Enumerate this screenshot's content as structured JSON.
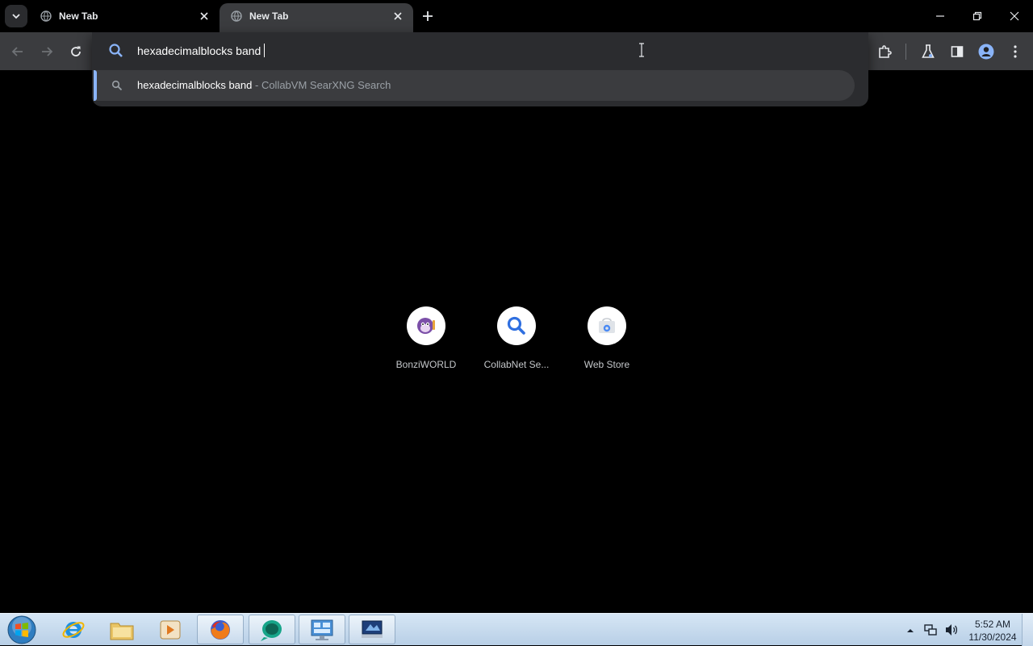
{
  "browser": {
    "tabs": [
      {
        "title": "New Tab",
        "active": false
      },
      {
        "title": "New Tab",
        "active": true
      }
    ],
    "omnibox": {
      "text": "hexadecimalblocks band",
      "suggestion": {
        "query": "hexadecimalblocks band",
        "separator": " - ",
        "engine": "CollabVM SearXNG Search"
      }
    },
    "shortcuts": [
      {
        "label": "BonziWORLD",
        "icon": "bonzi-icon"
      },
      {
        "label": "CollabNet Se...",
        "icon": "magnifier-icon"
      },
      {
        "label": "Web Store",
        "icon": "webstore-icon"
      }
    ]
  },
  "taskbar": {
    "apps": [
      "internet-explorer",
      "file-explorer",
      "media-player",
      "firefox",
      "collabvm",
      "control-panel",
      "remote-desktop"
    ],
    "clock": {
      "time": "5:52 AM",
      "date": "11/30/2024"
    }
  },
  "colors": {
    "accent": "#8ab4f8",
    "toolbar": "#3b3c3f",
    "background": "#000000"
  }
}
